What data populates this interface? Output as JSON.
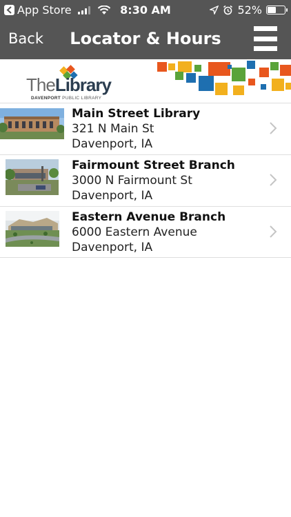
{
  "status_bar": {
    "back_app": "App Store",
    "time": "8:30 AM",
    "battery": "52%",
    "battery_level": 0.52
  },
  "nav": {
    "back": "Back",
    "title": "Locator & Hours",
    "menu_icon": "hamburger-menu-icon"
  },
  "banner": {
    "logo_the": "The",
    "logo_library": "Library",
    "logo_sub_bold": "DAVENPORT",
    "logo_sub_rest": " PUBLIC LIBRARY"
  },
  "locations": [
    {
      "name": "Main Street Library",
      "address": "321 N Main St",
      "city": "Davenport, IA"
    },
    {
      "name": "Fairmount Street Branch",
      "address": "3000 N Fairmount St",
      "city": "Davenport, IA"
    },
    {
      "name": "Eastern Avenue Branch",
      "address": "6000 Eastern Avenue",
      "city": "Davenport, IA"
    }
  ],
  "colors": {
    "nav_background": "#555555",
    "logo_dark": "#2c3e50",
    "mosaic_orange": "#e8571e",
    "mosaic_yellow": "#f2b01e",
    "mosaic_green": "#5aa33a",
    "mosaic_blue": "#1e6fb0"
  }
}
